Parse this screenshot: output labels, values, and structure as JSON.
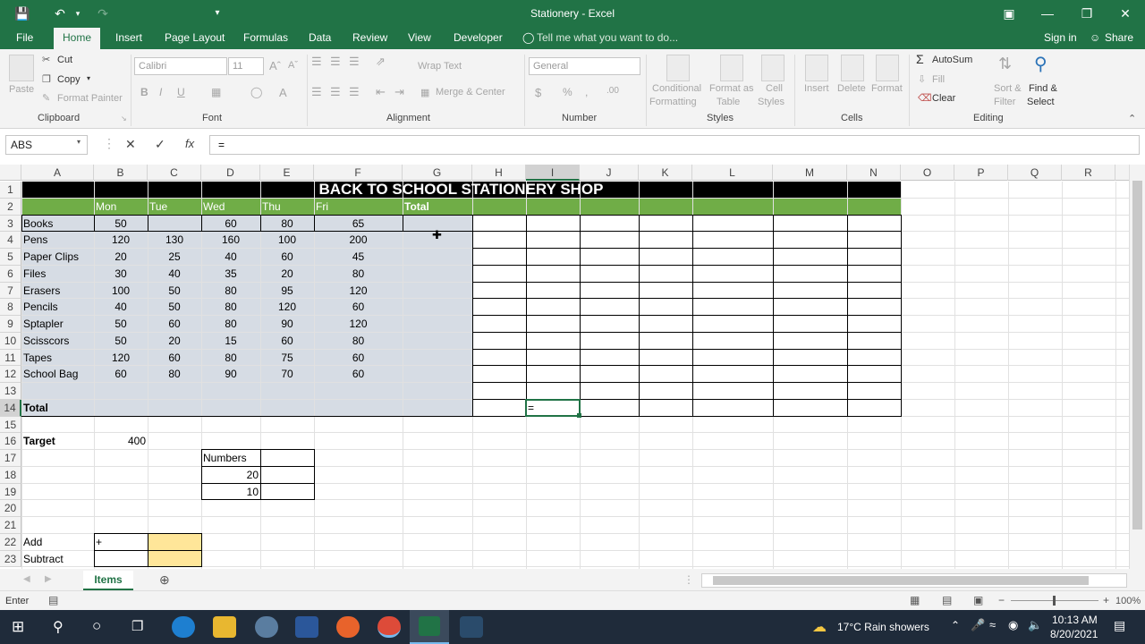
{
  "window": {
    "title": "Stationery - Excel"
  },
  "menu_tabs": [
    "File",
    "Home",
    "Insert",
    "Page Layout",
    "Formulas",
    "Data",
    "Review",
    "View",
    "Developer"
  ],
  "tell_me": "Tell me what you want to do...",
  "sign_in": "Sign in",
  "share": "Share",
  "ribbon": {
    "paste": "Paste",
    "cut": "Cut",
    "copy": "Copy",
    "format_painter": "Format Painter",
    "clipboard": "Clipboard",
    "font_name": "Calibri",
    "font_size": "11",
    "font": "Font",
    "wrap_text": "Wrap Text",
    "merge_center": "Merge & Center",
    "alignment": "Alignment",
    "number_format": "General",
    "number": "Number",
    "conditional_formatting": [
      "Conditional",
      "Formatting"
    ],
    "format_as_table": [
      "Format as",
      "Table"
    ],
    "cell_styles": [
      "Cell",
      "Styles"
    ],
    "styles": "Styles",
    "insert": "Insert",
    "delete": "Delete",
    "format": "Format",
    "cells": "Cells",
    "autosum": "AutoSum",
    "fill": "Fill",
    "clear": "Clear",
    "sort_filter": [
      "Sort &",
      "Filter"
    ],
    "find_select": [
      "Find &",
      "Select"
    ],
    "editing": "Editing"
  },
  "formula_bar": {
    "name_box": "ABS",
    "formula": "="
  },
  "columns": [
    "A",
    "B",
    "C",
    "D",
    "E",
    "F",
    "G",
    "H",
    "I",
    "J",
    "K",
    "L",
    "M",
    "N",
    "O",
    "P",
    "Q",
    "R"
  ],
  "sheet": {
    "title": "BACK TO SCHOOL STATIONERY SHOP",
    "headers": [
      "Mon",
      "Tue",
      "Wed",
      "Thu",
      "Fri",
      "Total"
    ],
    "rows": [
      {
        "item": "Books",
        "values": [
          "50",
          "",
          "60",
          "80",
          "65"
        ]
      },
      {
        "item": "Pens",
        "values": [
          "120",
          "130",
          "160",
          "100",
          "200"
        ]
      },
      {
        "item": "Paper Clips",
        "values": [
          "20",
          "25",
          "40",
          "60",
          "45"
        ]
      },
      {
        "item": "Files",
        "values": [
          "30",
          "40",
          "35",
          "20",
          "80"
        ]
      },
      {
        "item": "Erasers",
        "values": [
          "100",
          "50",
          "80",
          "95",
          "120"
        ]
      },
      {
        "item": "Pencils",
        "values": [
          "40",
          "50",
          "80",
          "120",
          "60"
        ]
      },
      {
        "item": "Sptapler",
        "values": [
          "50",
          "60",
          "80",
          "90",
          "120"
        ]
      },
      {
        "item": "Scisscors",
        "values": [
          "50",
          "20",
          "15",
          "60",
          "80"
        ]
      },
      {
        "item": "Tapes",
        "values": [
          "120",
          "60",
          "80",
          "75",
          "60"
        ]
      },
      {
        "item": "School Bag",
        "values": [
          "60",
          "80",
          "90",
          "70",
          "60"
        ]
      }
    ],
    "total_label": "Total",
    "active_cell_value": "=",
    "target_label": "Target",
    "target_value": "400",
    "numbers_label": "Numbers",
    "number_1": "20",
    "number_2": "10",
    "add_label": "Add",
    "add_symbol": "+",
    "subtract_label": "Subtract"
  },
  "sheet_tab": "Items",
  "status": {
    "mode": "Enter",
    "zoom": "100%"
  },
  "taskbar": {
    "weather": "17°C  Rain showers",
    "time": "10:13 AM",
    "date": "8/20/2021"
  },
  "colors": {
    "excel_green": "#217346",
    "header_green": "#70ad47",
    "gray_fill": "#d6dce4",
    "yellow": "#ffe699"
  }
}
